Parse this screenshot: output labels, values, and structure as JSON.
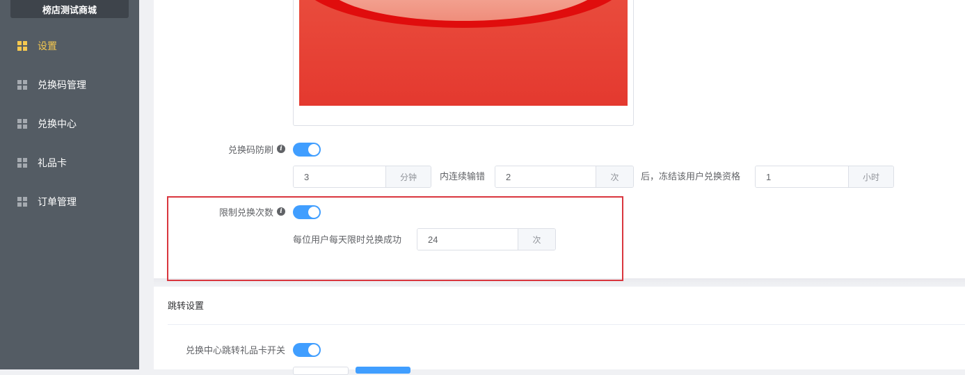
{
  "sidebar": {
    "store_name": "榜店测试商城",
    "items": [
      {
        "label": "设置",
        "active": true
      },
      {
        "label": "兑换码管理",
        "active": false
      },
      {
        "label": "兑换中心",
        "active": false
      },
      {
        "label": "礼品卡",
        "active": false
      },
      {
        "label": "订单管理",
        "active": false
      }
    ]
  },
  "anti_brush": {
    "label": "兑换码防刷",
    "enabled": true,
    "minutes": "3",
    "minutes_unit": "分钟",
    "text_mid": "内连续输错",
    "times": "2",
    "times_unit": "次",
    "text_after": "后，冻结该用户兑换资格",
    "hours": "1",
    "hours_unit": "小时"
  },
  "limit": {
    "label": "限制兑换次数",
    "enabled": true,
    "text": "每位用户每天限时兑换成功",
    "count": "24",
    "count_unit": "次"
  },
  "jump": {
    "section_title": "跳转设置",
    "toggle_label": "兑换中心跳转礼品卡开关",
    "enabled": true
  },
  "colors": {
    "sidebar_bg": "#545c64",
    "active": "#f5c84f",
    "primary": "#409eff",
    "highlight": "#d9363e"
  }
}
